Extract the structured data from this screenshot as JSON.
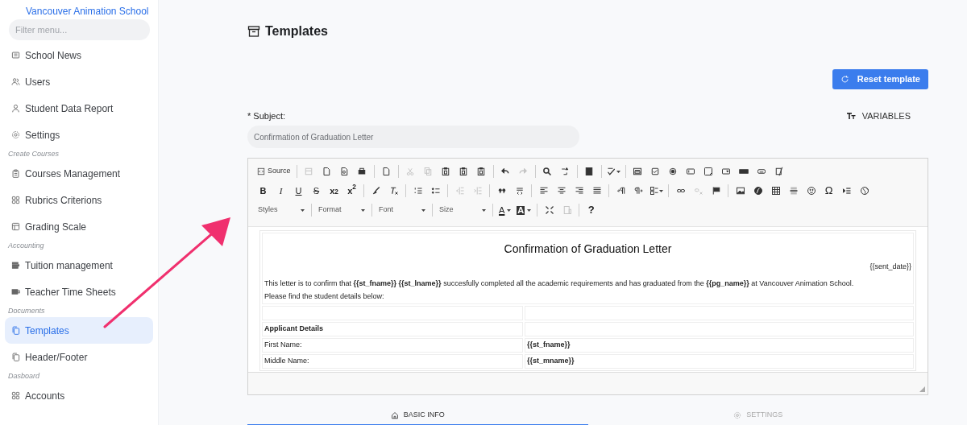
{
  "sidebar": {
    "brand": "Vancouver Animation School",
    "filter": {
      "placeholder": "Filter menu..."
    },
    "items": [
      {
        "kind": "item",
        "label": "School News",
        "selected": false
      },
      {
        "kind": "item",
        "label": "Users",
        "selected": false
      },
      {
        "kind": "item",
        "label": "Student Data Report",
        "selected": false
      },
      {
        "kind": "item",
        "label": "Settings",
        "selected": false
      },
      {
        "kind": "section",
        "label": "Create Courses"
      },
      {
        "kind": "item",
        "label": "Courses Management",
        "selected": false
      },
      {
        "kind": "item",
        "label": "Rubrics Criterions",
        "selected": false
      },
      {
        "kind": "item",
        "label": "Grading Scale",
        "selected": false
      },
      {
        "kind": "section",
        "label": "Accounting"
      },
      {
        "kind": "item",
        "label": "Tuition management",
        "selected": false
      },
      {
        "kind": "item",
        "label": "Teacher Time Sheets",
        "selected": false
      },
      {
        "kind": "section",
        "label": "Documents"
      },
      {
        "kind": "item",
        "label": "Templates",
        "selected": true
      },
      {
        "kind": "item",
        "label": "Header/Footer",
        "selected": false
      },
      {
        "kind": "section",
        "label": "Dasboard"
      },
      {
        "kind": "item",
        "label": "Accounts",
        "selected": false
      }
    ]
  },
  "page": {
    "title": "Templates",
    "reset_button": "Reset template",
    "subject_label": "* Subject:",
    "subject_value": "Confirmation of Graduation Letter",
    "variables": "VARIABLES"
  },
  "toolbar": {
    "source": "Source",
    "letters": [
      "B",
      "I",
      "U",
      "S",
      "x$_{2}$",
      "x$^{2}$",
      "Ω",
      "?"
    ],
    "dropdowns": [
      "Styles",
      "Format",
      "Font",
      "Size"
    ],
    "color_letters": [
      "A",
      "A"
    ]
  },
  "document": {
    "title": "Confirmation of Graduation Letter",
    "date": "{{sent_date}}",
    "paragraphs": [
      "This letter is to confirm that **{{st_fname}}** **{{st_lname}}** succesfully completed all the academic requirements and has graduated from the **{{pg_name}}** at Vancouver Animation School.",
      "Please find the student details below:"
    ],
    "rows": [
      {
        "kind": "blank"
      },
      {
        "kind": "heading",
        "label": "Applicant Details"
      },
      {
        "kind": "field",
        "label": "First Name:",
        "value": "{{st_fname}}"
      },
      {
        "kind": "field",
        "label": "Middle Name:",
        "value": "{{st_mname}}"
      }
    ]
  },
  "tabs": [
    {
      "label": "BASIC INFO",
      "selected": true
    },
    {
      "label": "SETTINGS",
      "selected": false
    }
  ]
}
